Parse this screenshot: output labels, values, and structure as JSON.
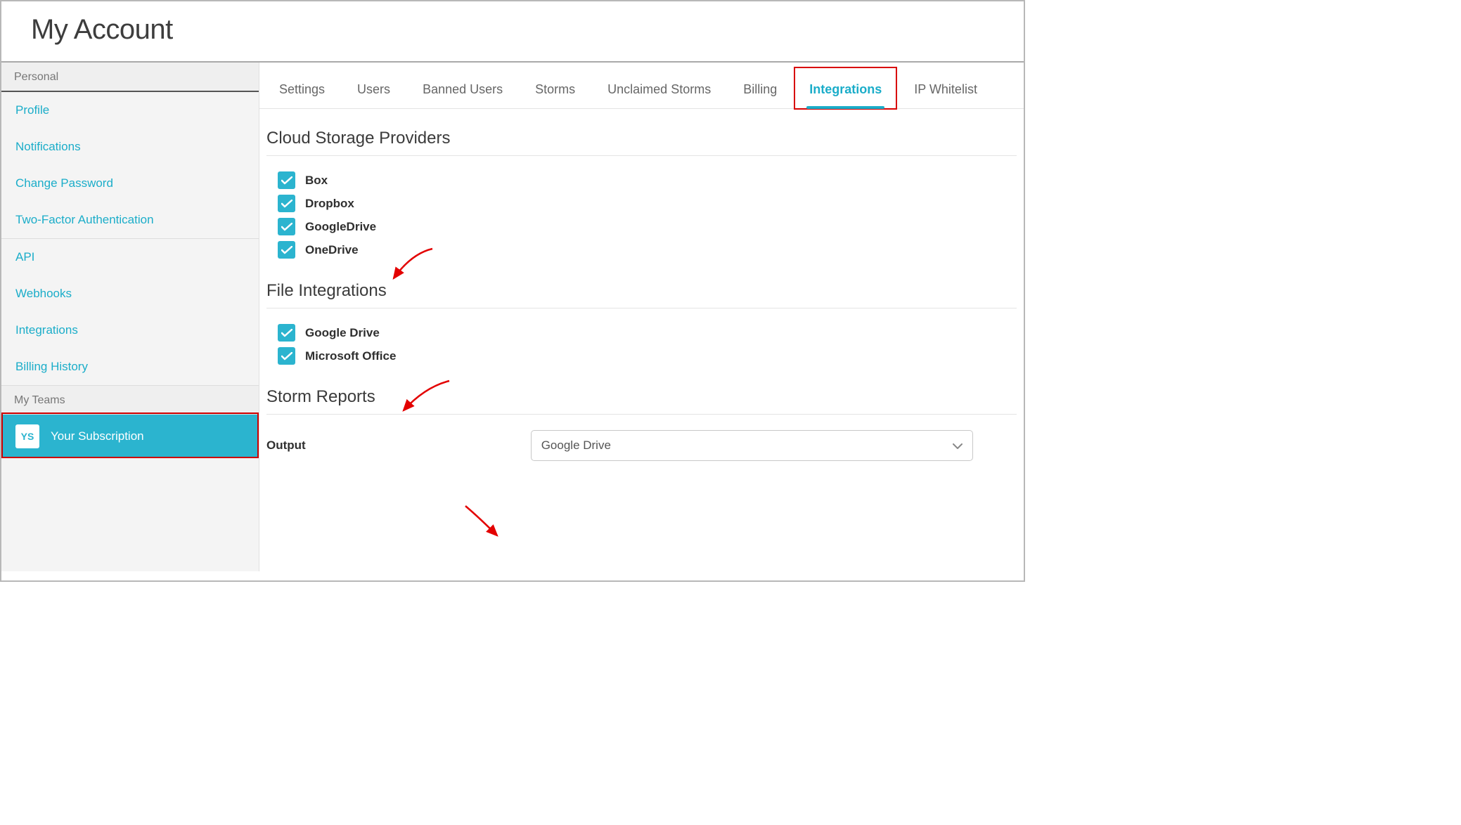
{
  "header": {
    "title": "My Account"
  },
  "sidebar": {
    "sections": [
      {
        "header": "Personal",
        "items": [
          "Profile",
          "Notifications",
          "Change Password",
          "Two-Factor Authentication"
        ]
      },
      {
        "header": null,
        "items": [
          "API",
          "Webhooks",
          "Integrations",
          "Billing History"
        ]
      }
    ],
    "teams_header": "My Teams",
    "team": {
      "badge": "YS",
      "label": "Your Subscription"
    }
  },
  "tabs": [
    {
      "label": "Settings",
      "active": false
    },
    {
      "label": "Users",
      "active": false
    },
    {
      "label": "Banned Users",
      "active": false
    },
    {
      "label": "Storms",
      "active": false
    },
    {
      "label": "Unclaimed Storms",
      "active": false
    },
    {
      "label": "Billing",
      "active": false
    },
    {
      "label": "Integrations",
      "active": true
    },
    {
      "label": "IP Whitelist",
      "active": false
    }
  ],
  "cloud_storage": {
    "title": "Cloud Storage Providers",
    "items": [
      {
        "label": "Box",
        "checked": true
      },
      {
        "label": "Dropbox",
        "checked": true
      },
      {
        "label": "GoogleDrive",
        "checked": true
      },
      {
        "label": "OneDrive",
        "checked": true
      }
    ]
  },
  "file_integrations": {
    "title": "File Integrations",
    "items": [
      {
        "label": "Google Drive",
        "checked": true
      },
      {
        "label": "Microsoft Office",
        "checked": true
      }
    ]
  },
  "storm_reports": {
    "title": "Storm Reports",
    "output_label": "Output",
    "output_value": "Google Drive"
  }
}
